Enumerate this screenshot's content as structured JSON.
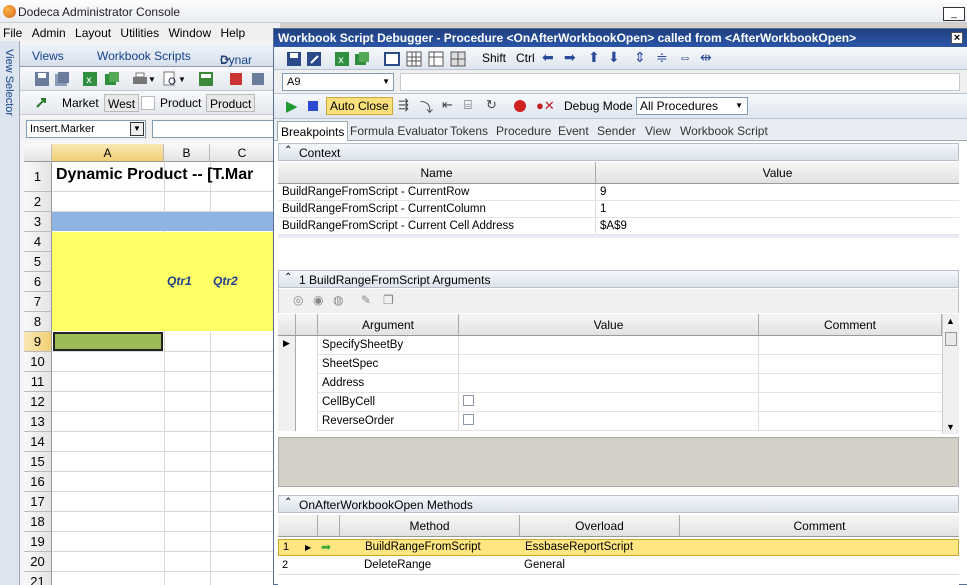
{
  "window": {
    "title": "Dodeca Administrator Console"
  },
  "menu": [
    {
      "label": "File"
    },
    {
      "label": "Admin"
    },
    {
      "label": "Layout"
    },
    {
      "label": "Utilities"
    },
    {
      "label": "Window"
    },
    {
      "label": "Help"
    }
  ],
  "view_selector": {
    "label": "View Selector"
  },
  "left_tabs": [
    "Views",
    "Workbook Scripts",
    "Dynar"
  ],
  "left_toolbar": {
    "market_label": "Market",
    "market_value": "West",
    "product_label": "Product",
    "product_value": "Product"
  },
  "namebox": {
    "value": "Insert.Marker"
  },
  "sheet": {
    "columns": [
      "A",
      "B",
      "C"
    ],
    "rows": [
      "1",
      "2",
      "3",
      "4",
      "5",
      "6",
      "7",
      "8",
      "9",
      "10",
      "11",
      "12",
      "13",
      "14",
      "15",
      "16",
      "17",
      "18",
      "19",
      "20",
      "21"
    ],
    "title_cell": "Dynamic Product -- [T.Mar",
    "qtr1": "Qtr1",
    "qtr2": "Qtr2",
    "colors": {
      "band": "#8eb4e3",
      "yellow": "#ffff66",
      "green": "#9bbb59"
    }
  },
  "debugger": {
    "title": "Workbook Script Debugger - Procedure <OnAfterWorkbookOpen> called from <AfterWorkbookOpen>",
    "shift_label": "Shift",
    "ctrl_label": "Ctrl",
    "cell_ref": "A9",
    "auto_close_label": "Auto Close",
    "debug_mode_label": "Debug Mode",
    "debug_mode_value": "All Procedures",
    "tabs": [
      "Breakpoints",
      "Formula Evaluator",
      "Tokens",
      "Procedure",
      "Event",
      "Sender",
      "View",
      "Workbook Script"
    ],
    "context": {
      "header": "Context",
      "columns": [
        "Name",
        "Value"
      ],
      "rows": [
        {
          "name": "BuildRangeFromScript - CurrentRow",
          "value": "9"
        },
        {
          "name": "BuildRangeFromScript - CurrentColumn",
          "value": "1"
        },
        {
          "name": "BuildRangeFromScript - Current Cell Address",
          "value": "$A$9"
        }
      ]
    },
    "arguments": {
      "index": "1",
      "header": "BuildRangeFromScript Arguments",
      "columns": [
        "Argument",
        "Value",
        "Comment"
      ],
      "rows": [
        {
          "argument": "SpecifySheetBy",
          "value": "",
          "comment": ""
        },
        {
          "argument": "SheetSpec",
          "value": "",
          "comment": ""
        },
        {
          "argument": "Address",
          "value": "",
          "comment": ""
        },
        {
          "argument": "CellByCell",
          "value": "",
          "comment": ""
        },
        {
          "argument": "ReverseOrder",
          "value": "",
          "comment": ""
        }
      ]
    },
    "methods": {
      "header": "OnAfterWorkbookOpen Methods",
      "columns": [
        "Method",
        "Overload",
        "Comment"
      ],
      "rows": [
        {
          "index": "1",
          "method": "BuildRangeFromScript",
          "overload": "EssbaseReportScript",
          "comment": ""
        },
        {
          "index": "2",
          "method": "DeleteRange",
          "overload": "General",
          "comment": ""
        }
      ]
    }
  }
}
